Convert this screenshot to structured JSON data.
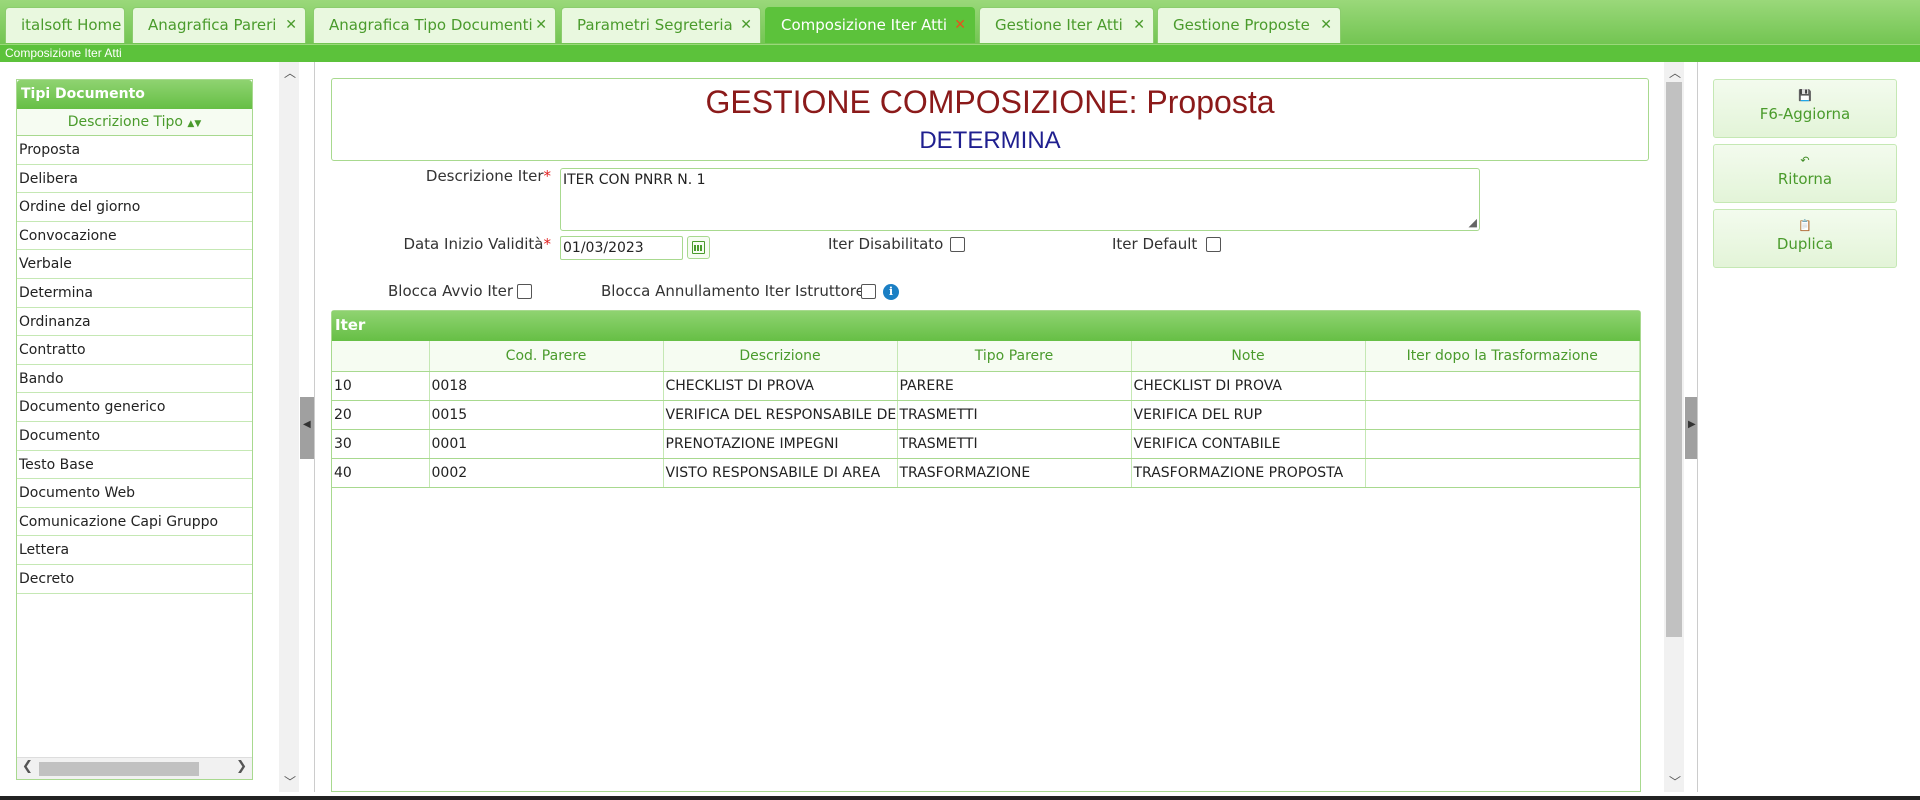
{
  "tabs": [
    {
      "label": "italsoft Home",
      "closable": false
    },
    {
      "label": "Anagrafica Pareri",
      "closable": true
    },
    {
      "label": "Anagrafica Tipo Documenti",
      "closable": true
    },
    {
      "label": "Parametri Segreteria",
      "closable": true
    },
    {
      "label": "Composizione Iter Atti",
      "closable": true,
      "active": true
    },
    {
      "label": "Gestione Iter Atti",
      "closable": true
    },
    {
      "label": "Gestione Proposte",
      "closable": true
    }
  ],
  "tab_close_glyph": "✕",
  "breadcrumb": "Composizione Iter Atti",
  "left_panel": {
    "title": "Tipi Documento",
    "column": "Descrizione Tipo",
    "items": [
      "Proposta",
      "Delibera",
      "Ordine del giorno",
      "Convocazione",
      "Verbale",
      "Determina",
      "Ordinanza",
      "Contratto",
      "Bando",
      "Documento generico",
      "Documento",
      "Testo Base",
      "Documento Web",
      "Comunicazione Capi Gruppo",
      "Lettera",
      "Decreto"
    ]
  },
  "header": {
    "title": "GESTIONE COMPOSIZIONE: Proposta",
    "subtitle": "DETERMINA"
  },
  "form": {
    "descrizione_iter_label": "Descrizione Iter",
    "descrizione_iter_value": "ITER CON PNRR N. 1",
    "data_inizio_label": "Data Inizio Validità",
    "data_inizio_value": "01/03/2023",
    "iter_disabilitato_label": "Iter Disabilitato",
    "iter_default_label": "Iter Default",
    "blocca_avvio_label": "Blocca Avvio Iter",
    "blocca_annullamento_label": "Blocca Annullamento Iter Istruttore",
    "required_mark": "*",
    "info_glyph": "i"
  },
  "grid": {
    "title": "Iter",
    "columns": [
      "",
      "Cod. Parere",
      "Descrizione",
      "Tipo Parere",
      "Note",
      "Iter dopo la Trasformazione"
    ],
    "rows": [
      [
        "10",
        "0018",
        "CHECKLIST DI PROVA",
        "PARERE",
        "CHECKLIST DI PROVA",
        ""
      ],
      [
        "20",
        "0015",
        "VERIFICA DEL RESPONSABILE DEL PROCEDIMENTO",
        "TRASMETTI",
        "VERIFICA DEL RUP",
        ""
      ],
      [
        "30",
        "0001",
        "PRENOTAZIONE IMPEGNI",
        "TRASMETTI",
        "VERIFICA CONTABILE",
        ""
      ],
      [
        "40",
        "0002",
        "VISTO RESPONSABILE DI AREA",
        "TRASFORMAZIONE",
        "TRASFORMAZIONE PROPOSTA",
        ""
      ]
    ]
  },
  "actions": [
    {
      "label": "F6-Aggiorna",
      "icon": "save-icon",
      "glyph": "💾"
    },
    {
      "label": "Ritorna",
      "icon": "undo-icon",
      "glyph": "↶"
    },
    {
      "label": "Duplica",
      "icon": "copy-icon",
      "glyph": "📋"
    }
  ],
  "colors": {
    "accent": "#5cc23b",
    "title": "#8b1a1a",
    "subtitle": "#1f1f8f"
  }
}
